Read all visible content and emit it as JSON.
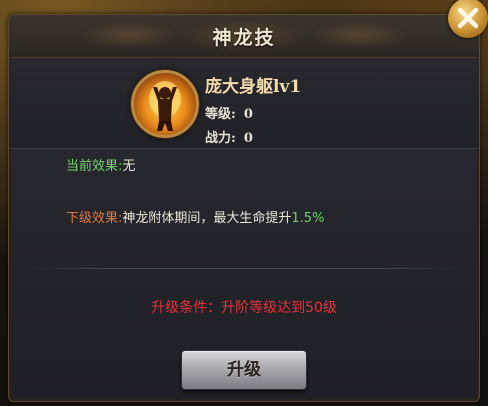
{
  "dialog": {
    "title": "神龙技",
    "close_icon": "close-x-icon"
  },
  "skill": {
    "icon": "dragon-skill-icon",
    "name": "庞大身躯lv1",
    "level_label": "等级:",
    "level_value": "0",
    "power_label": "战力:",
    "power_value": "0"
  },
  "effects": {
    "current_label": "当前效果:",
    "current_value": "无",
    "next_label": "下级效果:",
    "next_text": "神龙附体期间，最大生命提升",
    "next_highlight": "1.5%"
  },
  "upgrade": {
    "requirement": "升级条件：升阶等级达到50级",
    "button_label": "升级"
  },
  "colors": {
    "effect_green": "#73d56b",
    "next_orange": "#d97a44",
    "requirement_red": "#e7323b",
    "title_text": "#f1e6d2"
  }
}
